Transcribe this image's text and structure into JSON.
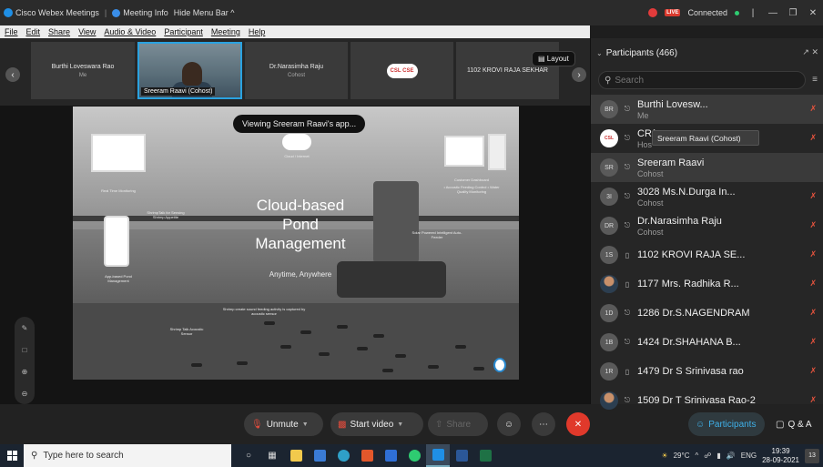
{
  "titlebar": {
    "app_name": "Cisco Webex Meetings",
    "meeting_info": "Meeting Info",
    "hide_menu": "Hide Menu Bar ^",
    "live_label": "LIVE",
    "connection": "Connected",
    "controls": [
      "|",
      "—",
      "❐",
      "✕"
    ]
  },
  "menu": [
    "File",
    "Edit",
    "Share",
    "View",
    "Audio & Video",
    "Participant",
    "Meeting",
    "Help"
  ],
  "video_strip": {
    "tiles": [
      {
        "name": "Burthi Loveswara Rao",
        "sub": "Me"
      },
      {
        "name": "Sreeram Raavi  (Cohost)",
        "sub": ""
      },
      {
        "name": "Dr.Narasimha Raju",
        "sub": "Cohost"
      },
      {
        "name": "",
        "sub": "",
        "badge": "CSL CSE"
      },
      {
        "name": "1102 KROVI RAJA SEKHAR",
        "sub": ""
      }
    ],
    "layout_label": "Layout"
  },
  "stage": {
    "viewing_label": "Viewing Sreeram Raavi's app...",
    "slide": {
      "title": "Cloud-based Pond Management",
      "tagline": "Anytime, Anywhere",
      "cloud_label": "Cloud / Internet",
      "rt_monitoring": "Real Time Monitoring",
      "customer_dashboard": "Customer Dashboard",
      "dashboard_bullets": "• Acoustic Feeding Control • Water Quality Monitoring",
      "shrimptalk": "ShrimpTalk for Sensing Shrimp Appetite",
      "app_based": "App-based Pond Management",
      "solar_feeder": "Solar Powered Intelligent Auto-Feeder",
      "acoustic": "Shrimp Talk Acoustic Sensor",
      "sound_note": "Shrimp create sound feeding activity is captured by acoustic sensor"
    }
  },
  "controls": {
    "unmute": "Unmute",
    "start_video": "Start video",
    "share": "Share",
    "participants": "Participants",
    "qa": "Q & A"
  },
  "panel": {
    "header": "Participants (466)",
    "search_placeholder": "Search",
    "tooltip": "Sreeram Raavi (Cohost)",
    "participants": [
      {
        "initials": "BR",
        "name": "Burthi Lovesw...",
        "role": "Me",
        "device": "headset",
        "highlight": true
      },
      {
        "initials": "CSL",
        "name": "CR(",
        "role": "Hos",
        "device": "headset",
        "highlight": false,
        "org": true
      },
      {
        "initials": "SR",
        "name": "Sreeram Raavi",
        "role": "Cohost",
        "device": "headset",
        "highlight": true
      },
      {
        "initials": "3I",
        "name": "3028 Ms.N.Durga In...",
        "role": "Cohost",
        "device": "headset",
        "highlight": false
      },
      {
        "initials": "DR",
        "name": "Dr.Narasimha Raju",
        "role": "Cohost",
        "device": "headset",
        "highlight": false
      },
      {
        "initials": "1S",
        "name": "1102 KROVI RAJA SE...",
        "role": "",
        "device": "phone",
        "highlight": false
      },
      {
        "initials": "",
        "name": "1177 Mrs. Radhika R...",
        "role": "",
        "device": "phone",
        "highlight": false,
        "photo": true
      },
      {
        "initials": "1D",
        "name": "1286 Dr.S.NAGENDRAM",
        "role": "",
        "device": "headset",
        "highlight": false
      },
      {
        "initials": "1B",
        "name": "1424 Dr.SHAHANA B...",
        "role": "",
        "device": "headset",
        "highlight": false
      },
      {
        "initials": "1R",
        "name": "1479 Dr S Srinivasa rao",
        "role": "",
        "device": "phone",
        "highlight": false
      },
      {
        "initials": "",
        "name": "1509 Dr T Srinivasa Rao-2",
        "role": "",
        "device": "headset",
        "highlight": false,
        "photo": true
      }
    ]
  },
  "taskbar": {
    "search_placeholder": "Type here to search",
    "weather": "29°C",
    "language": "ENG",
    "time": "19:39",
    "date": "28-09-2021",
    "notification_count": "13"
  },
  "colors": {
    "accent": "#2aa2e0",
    "muted_red": "#e5533d",
    "end_red": "#e0392b"
  }
}
